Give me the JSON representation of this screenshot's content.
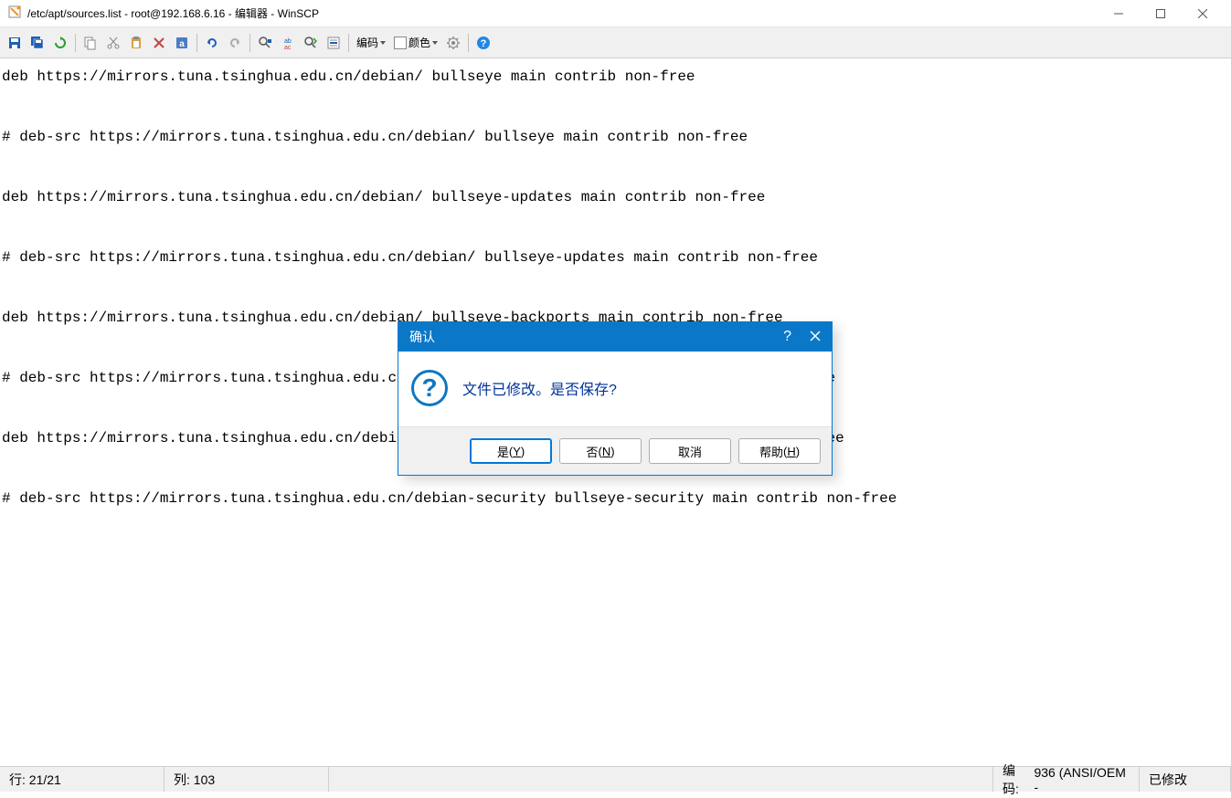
{
  "titlebar": {
    "title": "/etc/apt/sources.list - root@192.168.6.16 - 编辑器 - WinSCP"
  },
  "toolbar": {
    "encoding_label": "编码",
    "color_label": "颜色"
  },
  "editor": {
    "content": "deb https://mirrors.tuna.tsinghua.edu.cn/debian/ bullseye main contrib non-free\n\n# deb-src https://mirrors.tuna.tsinghua.edu.cn/debian/ bullseye main contrib non-free\n\ndeb https://mirrors.tuna.tsinghua.edu.cn/debian/ bullseye-updates main contrib non-free\n\n# deb-src https://mirrors.tuna.tsinghua.edu.cn/debian/ bullseye-updates main contrib non-free\n\ndeb https://mirrors.tuna.tsinghua.edu.cn/debian/ bullseye-backports main contrib non-free\n\n# deb-src https://mirrors.tuna.tsinghua.edu.cn/debian/ bullseye-backports main contrib non-free\n\ndeb https://mirrors.tuna.tsinghua.edu.cn/debian-security bullseye-security main contrib non-free\n\n# deb-src https://mirrors.tuna.tsinghua.edu.cn/debian-security bullseye-security main contrib non-free"
  },
  "statusbar": {
    "row_label": "行:",
    "row_value": "21/21",
    "col_label": "列:",
    "col_value": "103",
    "enc_label": "编码:",
    "enc_value": "936 (ANSI/OEM -",
    "modified": "已修改"
  },
  "dialog": {
    "title": "确认",
    "message": "文件已修改。是否保存?",
    "yes": "是",
    "yes_key": "Y",
    "no": "否",
    "no_key": "N",
    "cancel": "取消",
    "help": "帮助",
    "help_key": "H",
    "help_symbol": "?"
  }
}
